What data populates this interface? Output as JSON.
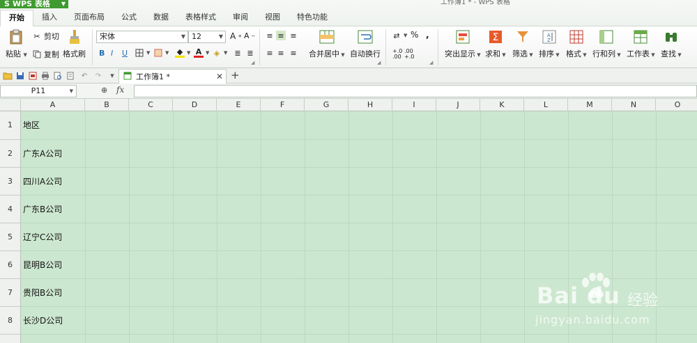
{
  "app": {
    "name": "WPS 表格",
    "doc_title": "工作簿1 * - WPS 表格"
  },
  "menu_tabs": [
    "开始",
    "插入",
    "页面布局",
    "公式",
    "数据",
    "表格样式",
    "审阅",
    "视图",
    "特色功能"
  ],
  "ribbon": {
    "paste": "粘贴",
    "cut": "剪切",
    "copy": "复制",
    "format_painter": "格式刷",
    "font_name": "宋体",
    "font_size": "12",
    "merge_center": "合并居中",
    "auto_wrap": "自动换行",
    "percent": "%",
    "comma": ",",
    "inc_decimal": "+.0 .00",
    "dec_decimal": ".00 +.0",
    "highlight": "突出显示",
    "sum": "求和",
    "filter": "筛选",
    "sort": "排序",
    "format": "格式",
    "row_col": "行和列",
    "worksheet": "工作表",
    "find": "查找",
    "bold": "B",
    "italic": "I",
    "underline": "U"
  },
  "doc_tab": {
    "label": "工作簿1 *"
  },
  "formula_bar": {
    "name_box": "P11",
    "fx": "fx",
    "content": ""
  },
  "columns": [
    "A",
    "B",
    "C",
    "D",
    "E",
    "F",
    "G",
    "H",
    "I",
    "J",
    "K",
    "L",
    "M",
    "N",
    "O"
  ],
  "rows": [
    {
      "num": "1",
      "a": "地区"
    },
    {
      "num": "2",
      "a": "广东A公司"
    },
    {
      "num": "3",
      "a": "四川A公司"
    },
    {
      "num": "4",
      "a": "广东B公司"
    },
    {
      "num": "5",
      "a": "辽宁C公司"
    },
    {
      "num": "6",
      "a": "昆明B公司"
    },
    {
      "num": "7",
      "a": "贵阳B公司"
    },
    {
      "num": "8",
      "a": "长沙D公司"
    }
  ],
  "watermark": {
    "brand": "Bai du",
    "cn": "经验",
    "url": "jingyan.baidu.com"
  },
  "colors": {
    "brand_green": "#3f9a2f",
    "grid_bg": "#cce7cf"
  }
}
